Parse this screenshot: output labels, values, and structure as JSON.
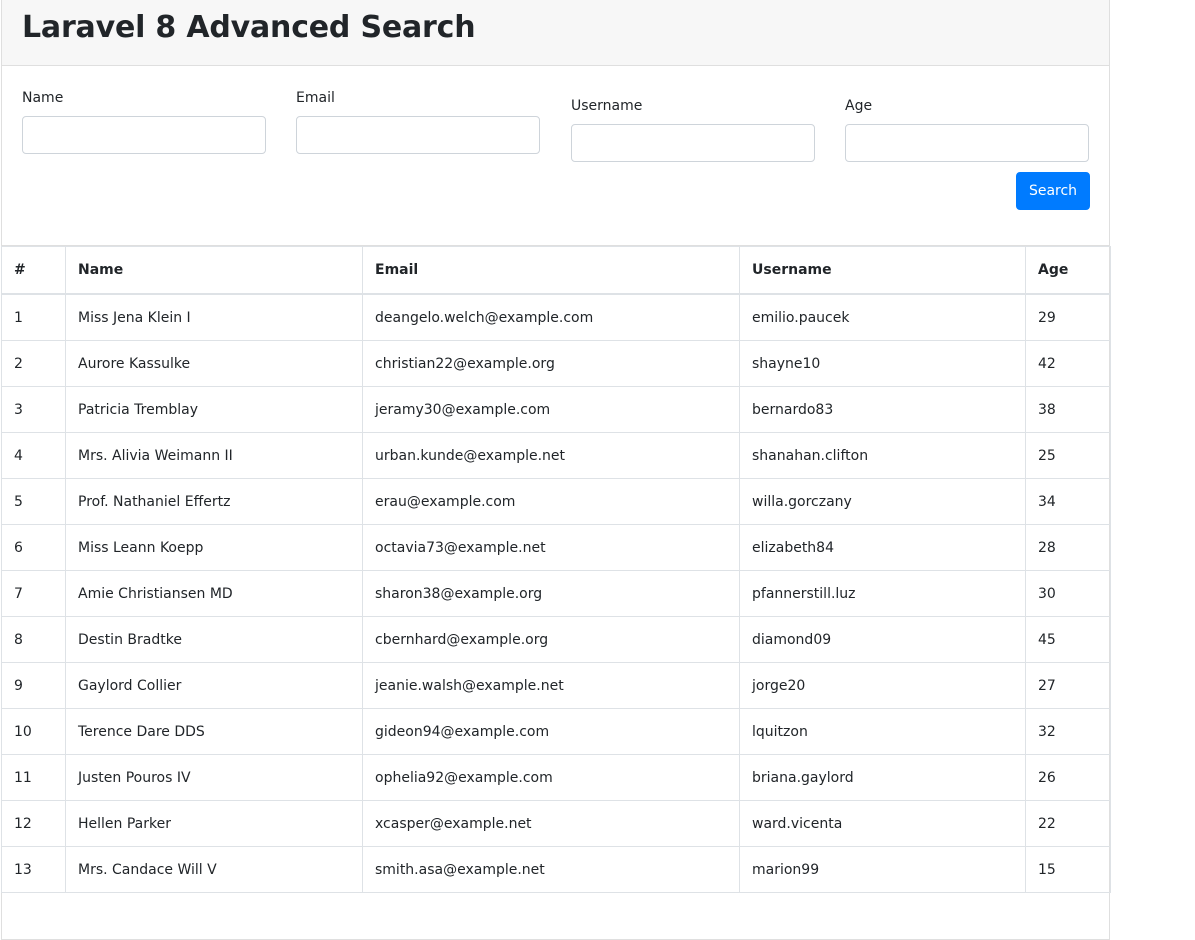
{
  "header": {
    "title": "Laravel 8 Advanced Search"
  },
  "form": {
    "name_label": "Name",
    "email_label": "Email",
    "username_label": "Username",
    "age_label": "Age",
    "name_value": "",
    "email_value": "",
    "username_value": "",
    "age_value": "",
    "search_label": "Search"
  },
  "table": {
    "columns": [
      "#",
      "Name",
      "Email",
      "Username",
      "Age"
    ],
    "rows": [
      [
        "1",
        "Miss Jena Klein I",
        "deangelo.welch@example.com",
        "emilio.paucek",
        "29"
      ],
      [
        "2",
        "Aurore Kassulke",
        "christian22@example.org",
        "shayne10",
        "42"
      ],
      [
        "3",
        "Patricia Tremblay",
        "jeramy30@example.com",
        "bernardo83",
        "38"
      ],
      [
        "4",
        "Mrs. Alivia Weimann II",
        "urban.kunde@example.net",
        "shanahan.clifton",
        "25"
      ],
      [
        "5",
        "Prof. Nathaniel Effertz",
        "erau@example.com",
        "willa.gorczany",
        "34"
      ],
      [
        "6",
        "Miss Leann Koepp",
        "octavia73@example.net",
        "elizabeth84",
        "28"
      ],
      [
        "7",
        "Amie Christiansen MD",
        "sharon38@example.org",
        "pfannerstill.luz",
        "30"
      ],
      [
        "8",
        "Destin Bradtke",
        "cbernhard@example.org",
        "diamond09",
        "45"
      ],
      [
        "9",
        "Gaylord Collier",
        "jeanie.walsh@example.net",
        "jorge20",
        "27"
      ],
      [
        "10",
        "Terence Dare DDS",
        "gideon94@example.com",
        "lquitzon",
        "32"
      ],
      [
        "11",
        "Justen Pouros IV",
        "ophelia92@example.com",
        "briana.gaylord",
        "26"
      ],
      [
        "12",
        "Hellen Parker",
        "xcasper@example.net",
        "ward.vicenta",
        "22"
      ],
      [
        "13",
        "Mrs. Candace Will V",
        "smith.asa@example.net",
        "marion99",
        "15"
      ]
    ]
  }
}
